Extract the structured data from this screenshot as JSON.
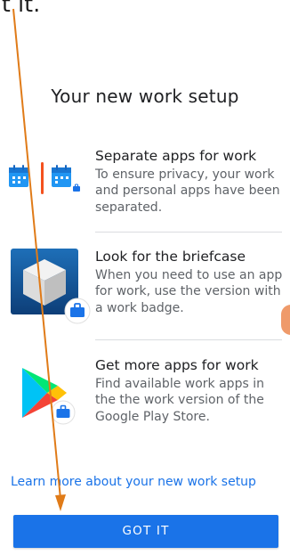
{
  "top_fragment": "t it.",
  "page_title": "Your new work setup",
  "features": [
    {
      "title": "Separate apps for work",
      "description": "To ensure privacy, your work and personal apps have been separated.",
      "icon": "calendar-split-icon"
    },
    {
      "title": "Look for the briefcase",
      "description": "When you need to use an app for work, use the version with a work badge.",
      "icon": "app-cube-work-badge-icon"
    },
    {
      "title": "Get more apps for work",
      "description": "Find available work apps in the the work version of the Google Play Store.",
      "icon": "play-store-work-badge-icon"
    }
  ],
  "learn_more_link": "Learn more about your new work setup",
  "got_it_button": "GOT IT",
  "colors": {
    "primary": "#1a73e8",
    "calendar": "#2196f3",
    "separator_accent": "#f4511e",
    "annotation_arrow": "#e07b18",
    "side_tab": "#ef9a6a"
  }
}
